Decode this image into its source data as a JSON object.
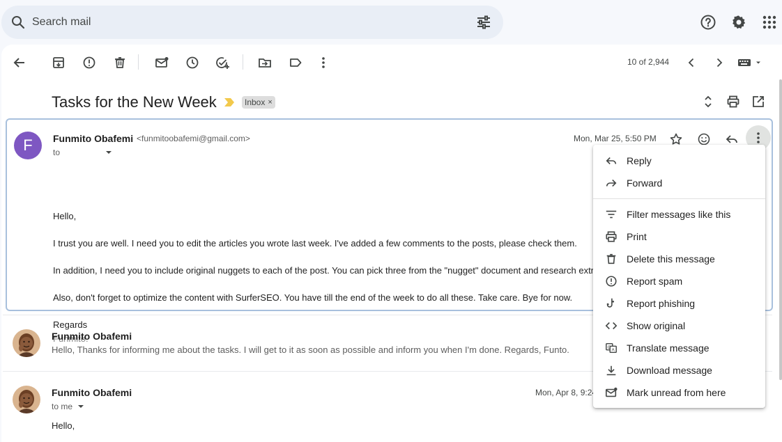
{
  "search": {
    "placeholder": "Search mail"
  },
  "toolbar": {
    "pager": "10 of 2,944"
  },
  "thread": {
    "subject": "Tasks for the New Week",
    "label": "Inbox"
  },
  "message1": {
    "avatar_letter": "F",
    "sender": "Funmito Obafemi",
    "email": "<funmitoobafemi@gmail.com>",
    "recipient_prefix": "to",
    "date": "Mon, Mar 25, 5:50 PM",
    "lines": [
      "Hello,",
      "I trust you are well. I need you to edit the articles you wrote last week. I've added a few comments to the posts, please check them.",
      "In addition, I need you to include original nuggets to each of the post. You can pick three from the \"nugget\" document and research extr",
      "Also, don't forget to optimize the content with SurferSEO. You have till the end of the week to do all these. Take care. Bye for now.",
      "Regards"
    ],
    "signature": "Funmito."
  },
  "message2": {
    "sender": "Funmito Obafemi",
    "snippet": "Hello, Thanks for informing me about the tasks. I will get to it as soon as possible and inform you when I'm done. Regards, Funto."
  },
  "message3": {
    "sender": "Funmito Obafemi",
    "recipient": "to me",
    "date": "Mon, Apr 8, 9:24",
    "greeting": "Hello,"
  },
  "menu": {
    "items": [
      {
        "label": "Reply",
        "icon": "reply-icon"
      },
      {
        "label": "Forward",
        "icon": "forward-icon"
      },
      {
        "label": "Filter messages like this",
        "icon": "filter-icon"
      },
      {
        "label": "Print",
        "icon": "print-icon"
      },
      {
        "label": "Delete this message",
        "icon": "trash-icon"
      },
      {
        "label": "Report spam",
        "icon": "spam-icon"
      },
      {
        "label": "Report phishing",
        "icon": "phishing-icon"
      },
      {
        "label": "Show original",
        "icon": "code-icon"
      },
      {
        "label": "Translate message",
        "icon": "translate-icon"
      },
      {
        "label": "Download message",
        "icon": "download-icon"
      },
      {
        "label": "Mark unread from here",
        "icon": "mark-unread-icon"
      }
    ]
  },
  "colors": {
    "accent": "#0b57d0",
    "avatar": "#7e57c2",
    "selected_border": "#a8c0dd",
    "important": "#f2c94c"
  }
}
